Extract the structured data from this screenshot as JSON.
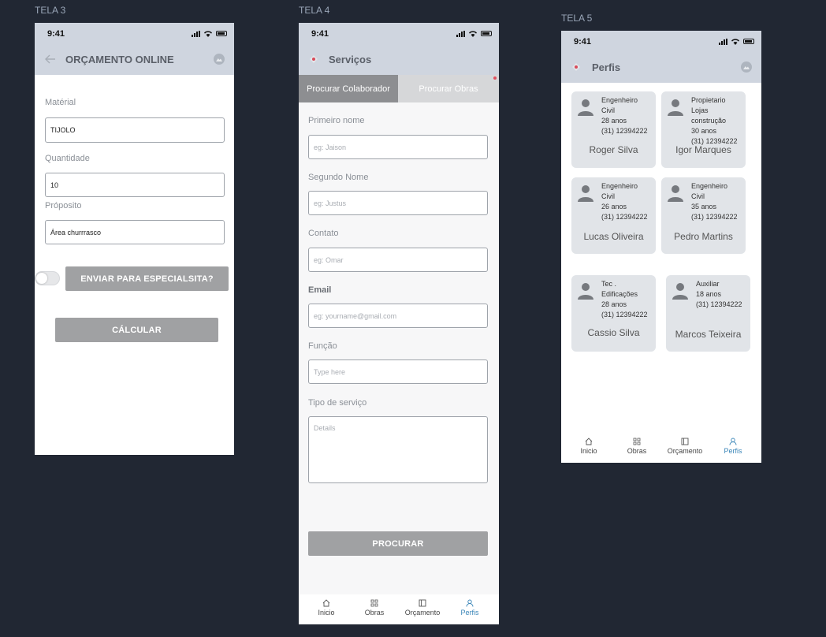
{
  "screens": {
    "tela3": {
      "label": "TELA 3",
      "time": "9:41",
      "title": "ORÇAMENTO ONLINE",
      "material_label": "Matérial",
      "material_value": "TIJOLO",
      "quantidade_label": "Quantidade",
      "quantidade_value": "10",
      "proposito_label": "Próposito",
      "proposito_value": "Área churrrasco",
      "enviar_button": "ENVIAR PARA ESPECIALSITA?",
      "calcular_button": "CÁLCULAR"
    },
    "tela4": {
      "label": "TELA 4",
      "time": "9:41",
      "title": "Serviços",
      "tabs": [
        "Procurar Colaborador",
        "Procurar Obras"
      ],
      "primeiro_nome_label": "Primeiro nome",
      "primeiro_nome_placeholder": "eg: Jaison",
      "segundo_nome_label": "Segundo Nome",
      "segundo_nome_placeholder": "eg: Justus",
      "contato_label": "Contato",
      "contato_placeholder": "eg: Omar",
      "email_label": "Email",
      "email_placeholder": "eg: yourname@gmail.com",
      "funcao_label": "Função",
      "funcao_placeholder": "Type here",
      "tipo_label": "Tipo de serviço",
      "tipo_placeholder": "Details",
      "procurar_button": "PROCURAR",
      "nav": [
        "Inicio",
        "Obras",
        "Orçamento",
        "Perfis"
      ]
    },
    "tela5": {
      "label": "TELA 5",
      "time": "9:41",
      "title": "Perfis",
      "profiles": [
        {
          "lines": [
            "Engenheiro",
            "Civil",
            "28 anos",
            "(31) 12394222"
          ],
          "name": "Roger Silva"
        },
        {
          "lines": [
            "Propietario",
            "Lojas",
            "construção",
            "30 anos",
            "(31) 12394222"
          ],
          "name": "Igor Marques"
        },
        {
          "lines": [
            "Engenheiro",
            "Civil",
            "26 anos",
            "(31) 12394222"
          ],
          "name": "Lucas Oliveira"
        },
        {
          "lines": [
            "Engenheiro",
            "Civil",
            "35 anos",
            "(31) 12394222"
          ],
          "name": "Pedro Martins"
        },
        {
          "lines": [
            "Tec .",
            "Edificações",
            "28 anos",
            "(31) 12394222"
          ],
          "name": "Cassio Silva"
        },
        {
          "lines": [
            "Auxiliar",
            "18 anos",
            "(31) 12394222"
          ],
          "name": "Marcos Teixeira"
        }
      ],
      "nav": [
        "Inicio",
        "Obras",
        "Orçamento",
        "Perfis"
      ]
    }
  },
  "colors": {
    "background": "#212733",
    "header": "#cfd5df",
    "button": "#a0a1a3",
    "card": "#e1e4e8",
    "nav_active": "#3b86b8"
  }
}
